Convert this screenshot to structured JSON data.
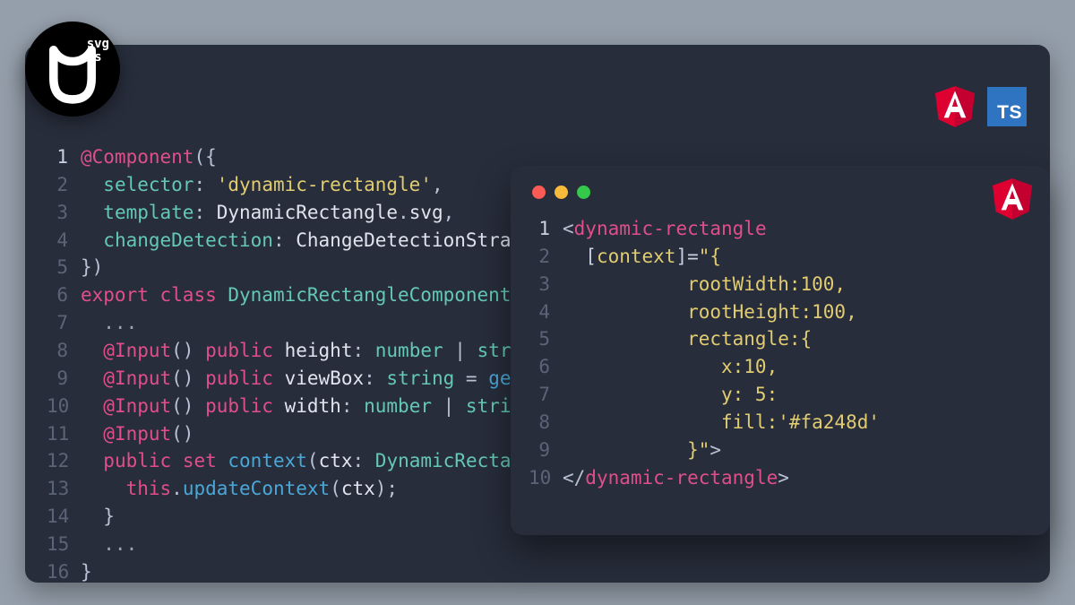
{
  "logo": {
    "line1": "svg",
    "line2": "ts"
  },
  "badges": {
    "angular": "A",
    "ts": "TS"
  },
  "editor": {
    "lines": [
      {
        "n": "1",
        "seg": [
          [
            "decorator",
            "@Component"
          ],
          [
            "punct",
            "({"
          ]
        ]
      },
      {
        "n": "2",
        "seg": [
          [
            "tok",
            "  "
          ],
          [
            "prop",
            "selector"
          ],
          [
            "punct",
            ": "
          ],
          [
            "str",
            "'dynamic-rectangle'"
          ],
          [
            "punct",
            ","
          ]
        ]
      },
      {
        "n": "3",
        "seg": [
          [
            "tok",
            "  "
          ],
          [
            "prop",
            "template"
          ],
          [
            "punct",
            ": "
          ],
          [
            "ident",
            "DynamicRectangle"
          ],
          [
            "punct",
            "."
          ],
          [
            "ident",
            "svg"
          ],
          [
            "punct",
            ","
          ]
        ]
      },
      {
        "n": "4",
        "seg": [
          [
            "tok",
            "  "
          ],
          [
            "prop",
            "changeDetection"
          ],
          [
            "punct",
            ": "
          ],
          [
            "ident",
            "ChangeDetectionStrate"
          ]
        ]
      },
      {
        "n": "5",
        "seg": [
          [
            "punct",
            "})"
          ]
        ]
      },
      {
        "n": "6",
        "seg": [
          [
            "kw",
            "export "
          ],
          [
            "kw",
            "class "
          ],
          [
            "type",
            "DynamicRectangleComponent"
          ],
          [
            "punct",
            " {"
          ]
        ]
      },
      {
        "n": "7",
        "seg": [
          [
            "pale",
            "  ..."
          ]
        ]
      },
      {
        "n": "8",
        "seg": [
          [
            "tok",
            "  "
          ],
          [
            "decorator",
            "@Input"
          ],
          [
            "punct",
            "() "
          ],
          [
            "kw",
            "public "
          ],
          [
            "ident",
            "height"
          ],
          [
            "punct",
            ": "
          ],
          [
            "type",
            "number"
          ],
          [
            "punct",
            " | "
          ],
          [
            "type",
            "strin"
          ]
        ]
      },
      {
        "n": "9",
        "seg": [
          [
            "tok",
            "  "
          ],
          [
            "decorator",
            "@Input"
          ],
          [
            "punct",
            "() "
          ],
          [
            "kw",
            "public "
          ],
          [
            "ident",
            "viewBox"
          ],
          [
            "punct",
            ": "
          ],
          [
            "type",
            "string"
          ],
          [
            "punct",
            " = "
          ],
          [
            "fn",
            "getS"
          ]
        ]
      },
      {
        "n": "10",
        "seg": [
          [
            "tok",
            "  "
          ],
          [
            "decorator",
            "@Input"
          ],
          [
            "punct",
            "() "
          ],
          [
            "kw",
            "public "
          ],
          [
            "ident",
            "width"
          ],
          [
            "punct",
            ": "
          ],
          [
            "type",
            "number"
          ],
          [
            "punct",
            " | "
          ],
          [
            "type",
            "string"
          ]
        ]
      },
      {
        "n": "11",
        "seg": [
          [
            "tok",
            "  "
          ],
          [
            "decorator",
            "@Input"
          ],
          [
            "punct",
            "()"
          ]
        ]
      },
      {
        "n": "12",
        "seg": [
          [
            "tok",
            "  "
          ],
          [
            "kw",
            "public "
          ],
          [
            "kw",
            "set "
          ],
          [
            "fn",
            "context"
          ],
          [
            "punct",
            "("
          ],
          [
            "ident",
            "ctx"
          ],
          [
            "punct",
            ": "
          ],
          [
            "type",
            "DynamicRectang"
          ]
        ]
      },
      {
        "n": "13",
        "seg": [
          [
            "tok",
            "    "
          ],
          [
            "this",
            "this"
          ],
          [
            "punct",
            "."
          ],
          [
            "fn",
            "updateContext"
          ],
          [
            "punct",
            "("
          ],
          [
            "ident",
            "ctx"
          ],
          [
            "punct",
            ");"
          ]
        ]
      },
      {
        "n": "14",
        "seg": [
          [
            "punct",
            "  }"
          ]
        ]
      },
      {
        "n": "15",
        "seg": [
          [
            "pale",
            "  ..."
          ]
        ]
      },
      {
        "n": "16",
        "seg": [
          [
            "punct",
            "}"
          ]
        ]
      }
    ]
  },
  "window2": {
    "lines": [
      {
        "n": "1",
        "seg": [
          [
            "punct",
            "<"
          ],
          [
            "tag",
            "dynamic-rectangle"
          ]
        ]
      },
      {
        "n": "2",
        "seg": [
          [
            "tok",
            "  ["
          ],
          [
            "attr",
            "context"
          ],
          [
            "tok",
            "]="
          ],
          [
            "attr",
            "\"{"
          ]
        ]
      },
      {
        "n": "3",
        "seg": [
          [
            "attr",
            "           rootWidth:100,"
          ]
        ]
      },
      {
        "n": "4",
        "seg": [
          [
            "attr",
            "           rootHeight:100,"
          ]
        ]
      },
      {
        "n": "5",
        "seg": [
          [
            "attr",
            "           rectangle:{"
          ]
        ]
      },
      {
        "n": "6",
        "seg": [
          [
            "attr",
            "              x:10,"
          ]
        ]
      },
      {
        "n": "7",
        "seg": [
          [
            "attr",
            "              y: 5:"
          ]
        ]
      },
      {
        "n": "8",
        "seg": [
          [
            "attr",
            "              fill:'#fa248d'"
          ]
        ]
      },
      {
        "n": "9",
        "seg": [
          [
            "attr",
            "           }\""
          ],
          [
            "punct",
            ">"
          ]
        ]
      },
      {
        "n": "10",
        "seg": [
          [
            "punct",
            "</"
          ],
          [
            "tag",
            "dynamic-rectangle"
          ],
          [
            "punct",
            ">"
          ]
        ]
      }
    ]
  }
}
